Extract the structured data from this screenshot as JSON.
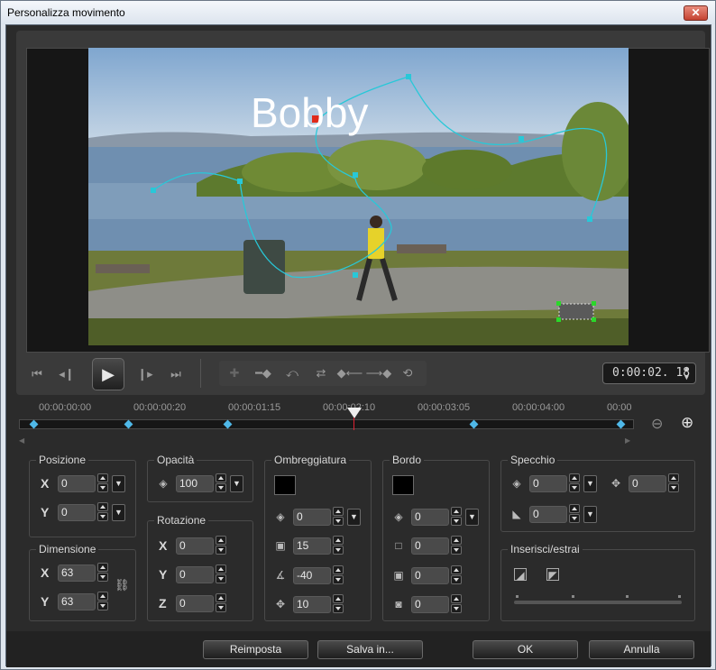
{
  "window": {
    "title": "Personalizza movimento",
    "close_glyph": "✕"
  },
  "preview": {
    "overlay_text": "Bobby",
    "sky_color": "#8fb3d6",
    "path_color": "#28c8d8"
  },
  "transport": {
    "buttons": [
      "skip-start-icon",
      "step-back-icon",
      "play-icon",
      "step-forward-icon",
      "skip-end-icon"
    ],
    "timecode": "0:00:02. 18"
  },
  "tools": [
    "add-keyframe-icon",
    "remove-keyframe-icon",
    "reverse-path-icon",
    "swap-icon",
    "move-left-icon",
    "move-right-icon",
    "reset-icon"
  ],
  "timeline": {
    "ticks": [
      "00:00:00:00",
      "00:00:00:20",
      "00:00:01:15",
      "00:00:02:10",
      "00:00:03:05",
      "00:00:04:00",
      "00:00"
    ],
    "keyframe_color": "#4fb8e8"
  },
  "posizione": {
    "label": "Posizione",
    "x_label": "X",
    "x": "0",
    "y_label": "Y",
    "y": "0"
  },
  "dimensione": {
    "label": "Dimensione",
    "x_label": "X",
    "x": "63",
    "y_label": "Y",
    "y": "63"
  },
  "opacita": {
    "label": "Opacità",
    "value": "100"
  },
  "rotazione": {
    "label": "Rotazione",
    "x_label": "X",
    "x": "0",
    "y_label": "Y",
    "y": "0",
    "z_label": "Z",
    "z": "0"
  },
  "ombreggiatura": {
    "label": "Ombreggiatura",
    "values": [
      "0",
      "15",
      "-40",
      "10"
    ]
  },
  "bordo": {
    "label": "Bordo",
    "values": [
      "0",
      "0",
      "0",
      "0"
    ]
  },
  "specchio": {
    "label": "Specchio",
    "v1": "0",
    "v2": "0",
    "v3": "0"
  },
  "inserisci": {
    "label": "Inserisci/estrai"
  },
  "buttons": {
    "reset": "Reimposta",
    "save": "Salva in...",
    "ok": "OK",
    "cancel": "Annulla"
  }
}
